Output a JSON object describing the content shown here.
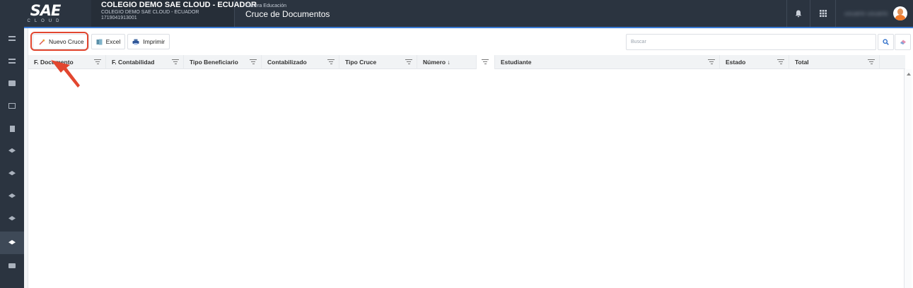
{
  "brand": {
    "logo_text": "SAE",
    "logo_sub": "CLOUD"
  },
  "company": {
    "name": "COLEGIO DEMO SAE CLOUD - ECUADOR",
    "subtitle": "COLEGIO DEMO SAE CLOUD - ECUADOR",
    "ruc": "1719041913001"
  },
  "module": {
    "section": "Cartera Educación",
    "title": "Cruce de Documentos"
  },
  "topbar": {
    "icons": [
      "bell-icon",
      "apps-grid-icon"
    ],
    "username": "usuario usuario"
  },
  "sidebar": {
    "items": [
      {
        "icon": "menu-lines-icon"
      },
      {
        "icon": "menu-lines-icon"
      },
      {
        "icon": "briefcase-icon"
      },
      {
        "icon": "grid-icon"
      },
      {
        "icon": "document-icon"
      },
      {
        "icon": "graduation-cap-icon"
      },
      {
        "icon": "graduation-cap-icon"
      },
      {
        "icon": "graduation-cap-icon"
      },
      {
        "icon": "graduation-cap-icon",
        "active": true
      },
      {
        "icon": "truck-icon"
      }
    ]
  },
  "toolbar": {
    "nuevo_label": "Nuevo Cruce",
    "excel_label": "Excel",
    "imprimir_label": "Imprimir"
  },
  "search": {
    "placeholder": "Buscar"
  },
  "grid": {
    "columns": [
      {
        "label": "F. Documento"
      },
      {
        "label": "F. Contabilidad"
      },
      {
        "label": "Tipo Beneficiario"
      },
      {
        "label": "Contabilizado"
      },
      {
        "label": "Tipo Cruce"
      },
      {
        "label": "Número ↓"
      },
      {
        "label": "Estudiante"
      },
      {
        "label": "Estado"
      },
      {
        "label": "Total"
      }
    ],
    "rows": []
  },
  "colors": {
    "topbar": "#2b3440",
    "accent": "#3a7bd5",
    "highlight": "#e2462f"
  }
}
